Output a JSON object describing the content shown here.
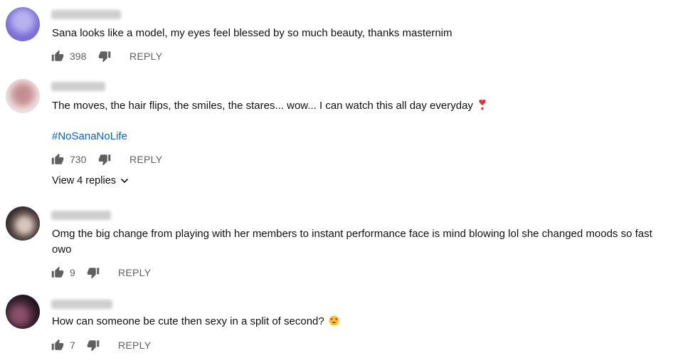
{
  "comments": [
    {
      "text": "Sana looks like a model, my eyes feel blessed by so much beauty, thanks masternim",
      "likes": "398",
      "reply_label": "REPLY",
      "avatar_color": "#7b6fd6"
    },
    {
      "text": "The moves, the hair flips, the smiles, the stares... wow... I can watch this all day everyday",
      "hashtag": "#NoSanaNoLife",
      "likes": "730",
      "reply_label": "REPLY",
      "view_replies": "View 4 replies",
      "avatar_color": "#c9a0a2"
    },
    {
      "text": "Omg the big change from playing with her members to instant performance face is mind blowing lol she changed moods so fast owo",
      "likes": "9",
      "reply_label": "REPLY",
      "avatar_color": "#3b3434"
    },
    {
      "text": "How can someone be cute then sexy in a split of second?",
      "likes": "7",
      "reply_label": "REPLY",
      "avatar_color": "#2e1f2a"
    }
  ],
  "colors": {
    "link": "#065fd4",
    "muted": "#606060",
    "icon": "#606060"
  },
  "icons": [
    "thumb-up-icon",
    "thumb-down-icon",
    "chevron-down-icon",
    "heart-exclamation-emoji",
    "heart-eyes-emoji"
  ]
}
